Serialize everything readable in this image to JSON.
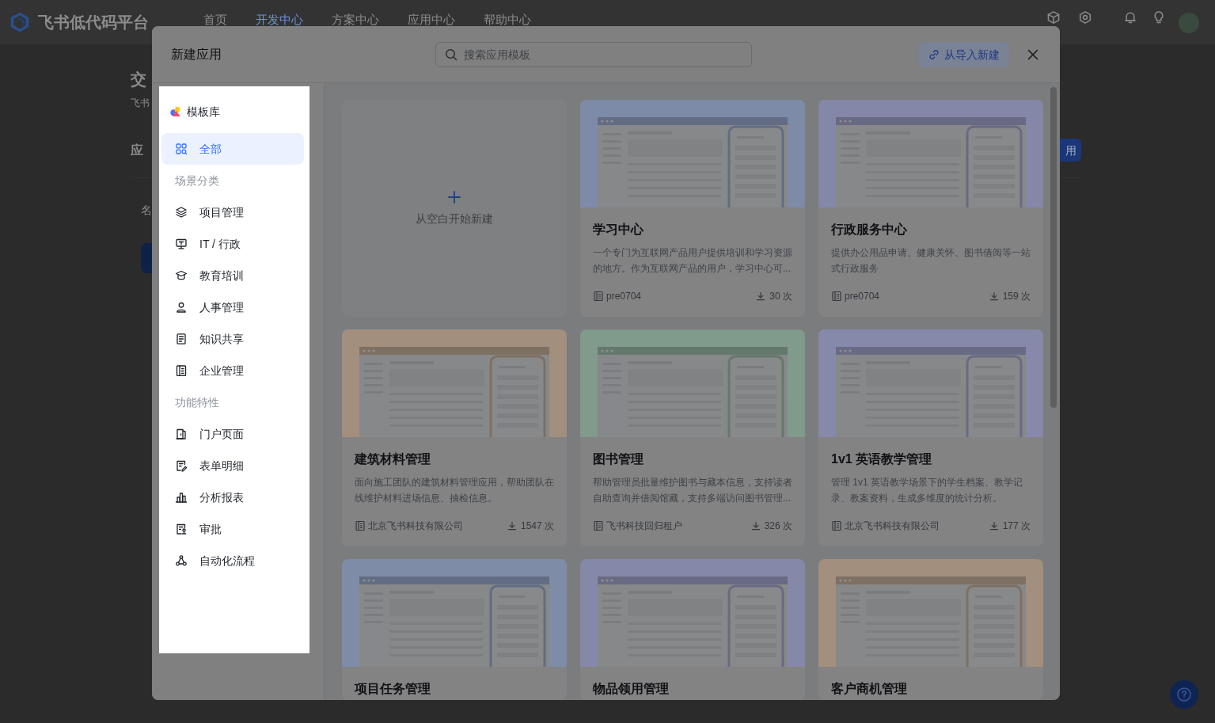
{
  "app_bar": {
    "logo_text": "飞书低代码平台",
    "nav": [
      {
        "label": "首页",
        "selected": false
      },
      {
        "label": "开发中心",
        "selected": true
      },
      {
        "label": "方案中心",
        "selected": false
      },
      {
        "label": "应用中心",
        "selected": false
      },
      {
        "label": "帮助中心",
        "selected": false
      }
    ]
  },
  "background_page": {
    "title": "交",
    "subtitle": "飞书",
    "section_heading": "应",
    "column_header": "名",
    "button": "用"
  },
  "dialog": {
    "title": "新建应用",
    "search": {
      "placeholder": "搜索应用模板"
    },
    "import_button": "从导入新建",
    "sidebar": {
      "title": "模板库",
      "items": [
        {
          "label": "全部",
          "selected": true
        }
      ],
      "groups": [
        {
          "heading": "场景分类",
          "items": [
            {
              "label": "项目管理",
              "selected": false
            },
            {
              "label": "IT / 行政",
              "selected": false
            },
            {
              "label": "教育培训",
              "selected": false
            },
            {
              "label": "人事管理",
              "selected": false
            },
            {
              "label": "知识共享",
              "selected": false
            },
            {
              "label": "企业管理",
              "selected": false
            }
          ]
        },
        {
          "heading": "功能特性",
          "items": [
            {
              "label": "门户页面",
              "selected": false
            },
            {
              "label": "表单明细",
              "selected": false
            },
            {
              "label": "分析报表",
              "selected": false
            },
            {
              "label": "审批",
              "selected": false
            },
            {
              "label": "自动化流程",
              "selected": false
            }
          ]
        }
      ]
    },
    "cards": [
      {
        "kind": "blank",
        "label": "从空白开始新建"
      },
      {
        "kind": "template",
        "title": "学习中心",
        "description": "一个专门为互联网产品用户提供培训和学习资源的地方。作为互联网产品的用户，学习中心可...",
        "author": "pre0704",
        "downloads": "30 次",
        "color": "#7d8aa8"
      },
      {
        "kind": "template",
        "title": "行政服务中心",
        "description": "提供办公用品申请、健康关怀、图书借阅等一站式行政服务",
        "author": "pre0704",
        "downloads": "159 次",
        "color": "#8587a8"
      },
      {
        "kind": "template",
        "title": "建筑材料管理",
        "description": "面向施工团队的建筑材料管理应用，帮助团队在线维护材料进场信息、抽检信息。",
        "author": "北京飞书科技有限公司",
        "downloads": "1547 次",
        "color": "#a28f7e"
      },
      {
        "kind": "template",
        "title": "图书管理",
        "description": "帮助管理员批量维护图书与藏本信息，支持读者自助查询并借阅馆藏，支持多端访问图书管理...",
        "author": "飞书科技回归租户",
        "downloads": "326 次",
        "color": "#809a8b"
      },
      {
        "kind": "template",
        "title": "1v1 英语教学管理",
        "description": "管理 1v1 英语教学场景下的学生档案、教学记录、教案资料，生成多维度的统计分析。",
        "author": "北京飞书科技有限公司",
        "downloads": "177 次",
        "color": "#8789aa"
      },
      {
        "kind": "template",
        "title": "项目任务管理",
        "color": "#7e8ca8"
      },
      {
        "kind": "template",
        "title": "物品领用管理",
        "color": "#8688a9"
      },
      {
        "kind": "template",
        "title": "客户商机管理",
        "color": "#a28f7e"
      }
    ]
  }
}
